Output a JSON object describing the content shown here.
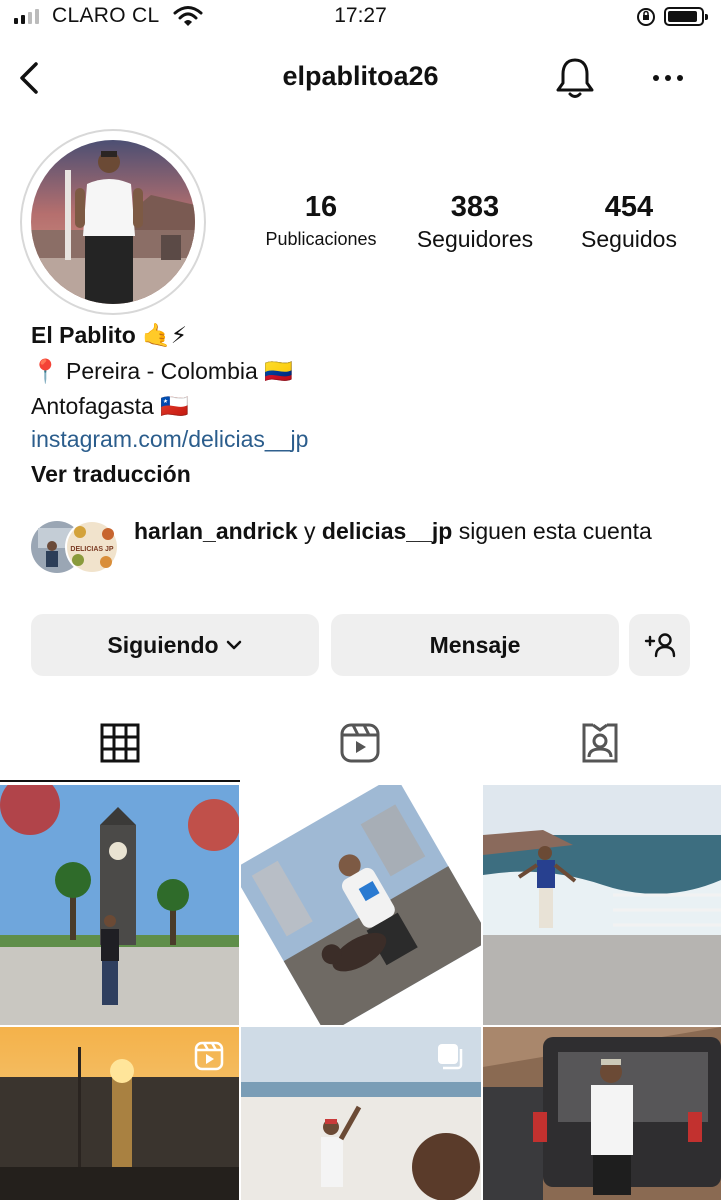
{
  "status_bar": {
    "carrier": "CLARO CL",
    "time": "17:27",
    "signal_bars": 4,
    "signal_bars_active": 2
  },
  "header": {
    "username": "elpablitoa26",
    "icons": [
      "back-arrow-icon",
      "bell-icon",
      "more-icon"
    ]
  },
  "stats": [
    {
      "value": "16",
      "label": "Publicaciones"
    },
    {
      "value": "383",
      "label": "Seguidores"
    },
    {
      "value": "454",
      "label": "Seguidos"
    }
  ],
  "bio": {
    "name": "El Pablito",
    "name_emoji": "🤙⚡",
    "location_pin": "📍",
    "location": "Pereira - Colombia",
    "location_flag": "🇨🇴",
    "city": "Antofagasta",
    "city_flag": "🇨🇱",
    "link": "instagram.com/delicias__jp",
    "translate": "Ver traducción"
  },
  "mutual": {
    "user1": "harlan_andrick",
    "connector": "y",
    "user2": "delicias__jp",
    "suffix": "siguen esta cuenta",
    "logo_text": "DELICIAS JP"
  },
  "actions": {
    "following_label": "Siguiendo",
    "message_label": "Mensaje",
    "add_user_icon": "add-user-icon"
  },
  "tabs": [
    {
      "icon": "grid-icon",
      "active": true
    },
    {
      "icon": "reels-icon",
      "active": false
    },
    {
      "icon": "tagged-icon",
      "active": false
    }
  ],
  "grid": [
    {
      "subject": "clock tower plaza",
      "badge": null
    },
    {
      "subject": "man with dog",
      "badge": null
    },
    {
      "subject": "coastal lookout",
      "badge": null
    },
    {
      "subject": "sunset over sea",
      "badge": "reel-icon"
    },
    {
      "subject": "sand dunes",
      "badge": "carousel-icon"
    },
    {
      "subject": "man by car",
      "badge": null
    }
  ],
  "colors": {
    "accent_link": "#2b5d8c",
    "button_bg": "#efefef",
    "text": "#111111"
  }
}
